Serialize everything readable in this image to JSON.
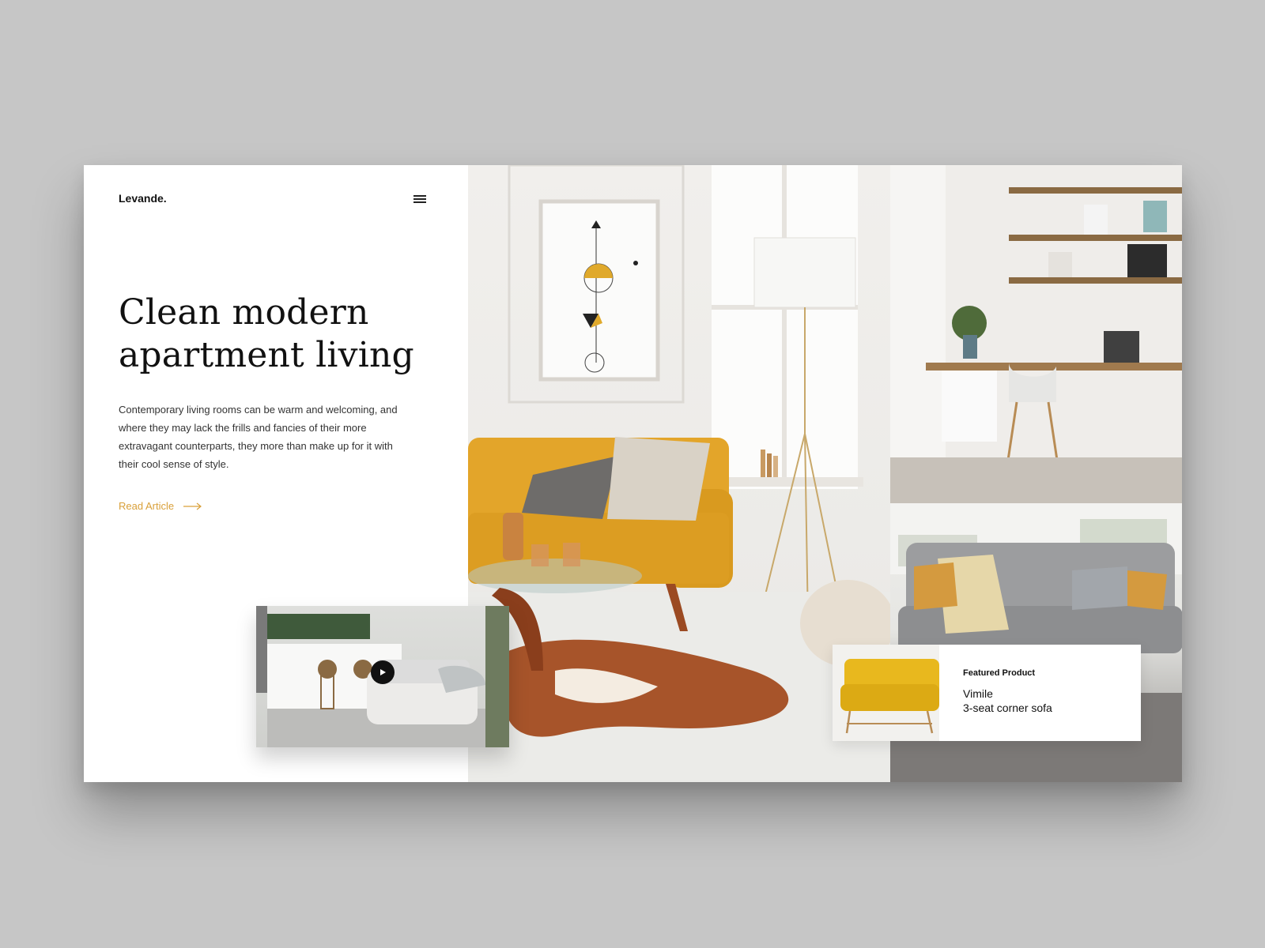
{
  "brand": {
    "logo": "Levande."
  },
  "header": {
    "menu_icon": "hamburger-icon"
  },
  "hero": {
    "headline_line1": "Clean modern",
    "headline_line2": "apartment living",
    "body": "Contemporary living rooms can be warm and welcoming, and where they may lack the frills and fancies of their more extravagant counterparts, they more than make up for it with their cool sense of style.",
    "cta_label": "Read Article",
    "cta_icon": "arrow-right-icon"
  },
  "video": {
    "play_icon": "play-icon"
  },
  "featured": {
    "label": "Featured Product",
    "name": "Vimile",
    "description": "3-seat corner sofa"
  },
  "colors": {
    "accent": "#d9a03a",
    "sofa_yellow": "#e3a52a",
    "text": "#111111",
    "backdrop": "#c6c6c6"
  }
}
